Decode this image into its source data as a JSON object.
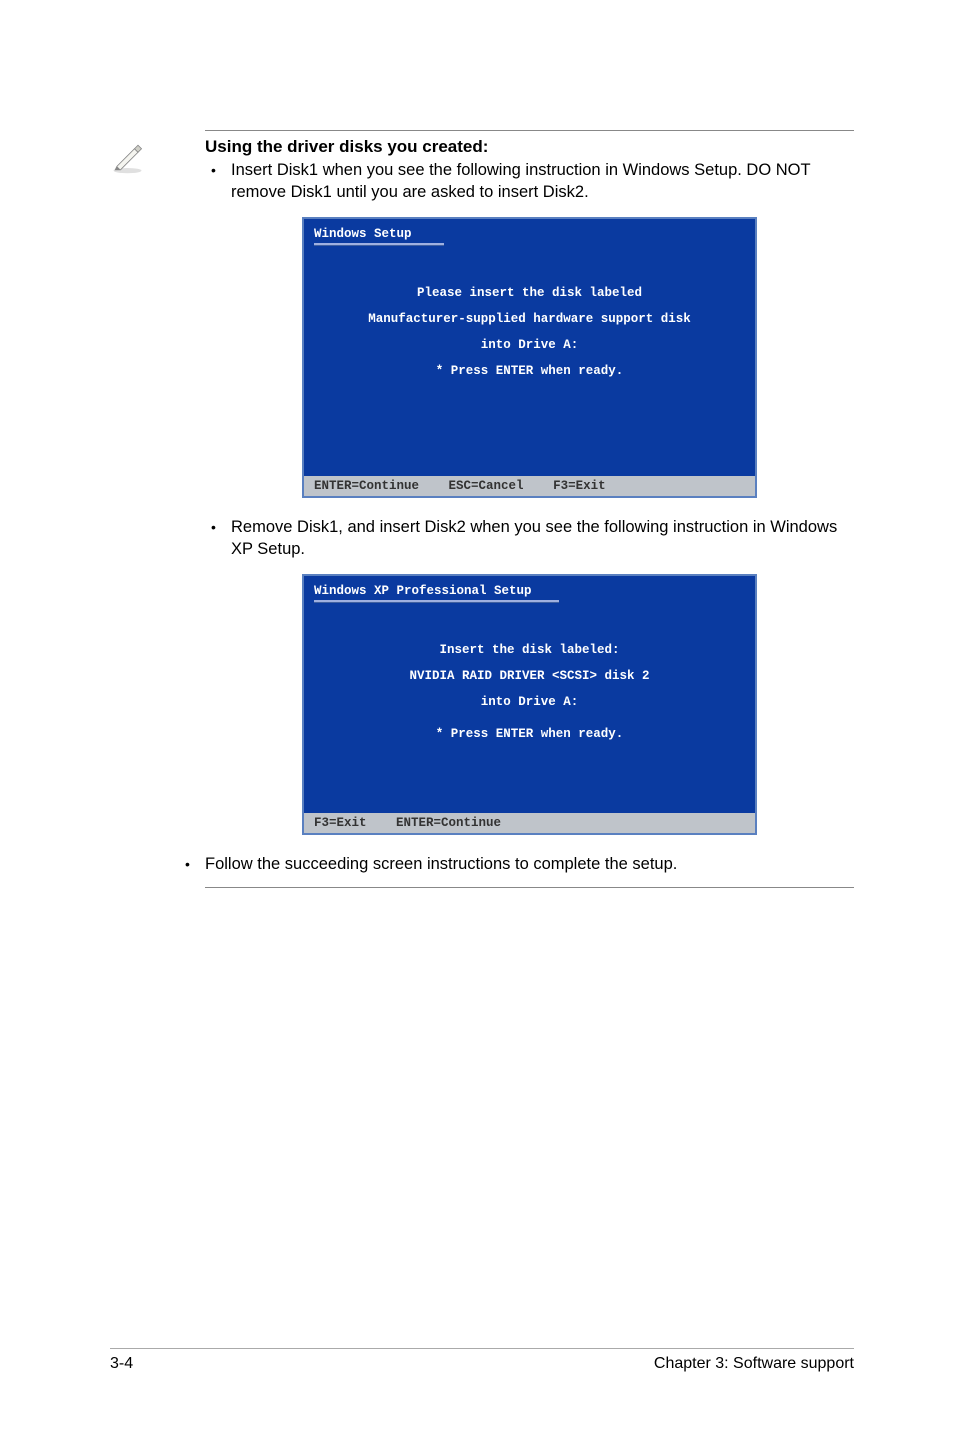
{
  "note": {
    "heading": "Using the driver disks you created:",
    "bullet1": "Insert Disk1 when you see the following instruction in Windows Setup. DO NOT remove Disk1 until you are asked to insert Disk2.",
    "bullet2": "Remove Disk1, and insert Disk2 when you see the following instruction in Windows XP Setup.",
    "bullet3": "Follow the succeeding screen instructions to complete the setup."
  },
  "terminal1": {
    "title": "Windows Setup",
    "line1": "Please insert the disk labeled",
    "line2": "Manufacturer-supplied hardware support disk",
    "line3": "into Drive A:",
    "line4": "*  Press ENTER when ready.",
    "footer1": "ENTER=Continue",
    "footer2": "ESC=Cancel",
    "footer3": "F3=Exit"
  },
  "terminal2": {
    "title": "Windows XP Professional Setup",
    "line1": "Insert the disk labeled:",
    "line2": "NVIDIA RAID DRIVER <SCSI> disk 2",
    "line3": "into Drive A:",
    "line4": "*  Press ENTER when ready.",
    "footer1": "F3=Exit",
    "footer2": "ENTER=Continue"
  },
  "footer": {
    "page": "3-4",
    "chapter": "Chapter 3: Software support"
  }
}
